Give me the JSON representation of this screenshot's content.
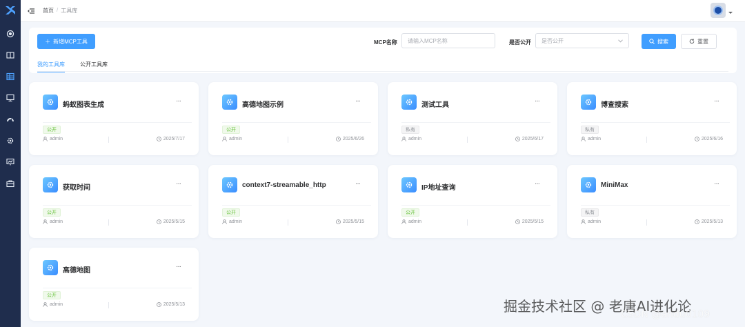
{
  "header": {
    "breadcrumb": [
      "首页",
      "工具库"
    ],
    "breadcrumb_sep": "/"
  },
  "toolbar": {
    "add_label": "新增MCP工具",
    "name_label": "MCP名称",
    "name_placeholder": "请输入MCP名称",
    "public_label": "是否公开",
    "public_placeholder": "是否公开",
    "search_label": "搜索",
    "reset_label": "重置"
  },
  "tabs": [
    {
      "label": "我的工具库",
      "active": true
    },
    {
      "label": "公开工具库",
      "active": false
    }
  ],
  "cards": [
    {
      "title": "蚂蚁图表生成",
      "badge": "公开",
      "status": "public",
      "user": "admin",
      "date": "2025/7/17"
    },
    {
      "title": "高德地图示例",
      "badge": "公开",
      "status": "public",
      "user": "admin",
      "date": "2025/6/26"
    },
    {
      "title": "测试工具",
      "badge": "私有",
      "status": "private",
      "user": "admin",
      "date": "2025/6/17"
    },
    {
      "title": "博查搜索",
      "badge": "私有",
      "status": "private",
      "user": "admin",
      "date": "2025/6/16"
    },
    {
      "title": "获取时间",
      "badge": "公开",
      "status": "public",
      "user": "admin",
      "date": "2025/5/15"
    },
    {
      "title": "context7-streamable_http",
      "badge": "公开",
      "status": "public",
      "user": "admin",
      "date": "2025/5/15"
    },
    {
      "title": "IP地址查询",
      "badge": "公开",
      "status": "public",
      "user": "admin",
      "date": "2025/5/15"
    },
    {
      "title": "MiniMax",
      "badge": "私有",
      "status": "private",
      "user": "admin",
      "date": "2025/5/13"
    },
    {
      "title": "高德地图",
      "badge": "公开",
      "status": "public",
      "user": "admin",
      "date": "2025/5/13"
    }
  ],
  "card_more": "···",
  "watermark": {
    "cn": "掘金技术社区 @ 老唐AI进化论",
    "csdn": "CSDN @andu0109"
  },
  "colors": {
    "primary": "#409eff",
    "sidebar": "#1f2d4d",
    "public_badge": "#67c23a",
    "private_badge": "#909399"
  },
  "icons": {
    "sidebar": [
      "dashboard-icon",
      "book-icon",
      "grid-icon",
      "monitor-icon",
      "gauge-icon",
      "gear-icon",
      "chart-screen-icon",
      "briefcase-icon"
    ]
  }
}
